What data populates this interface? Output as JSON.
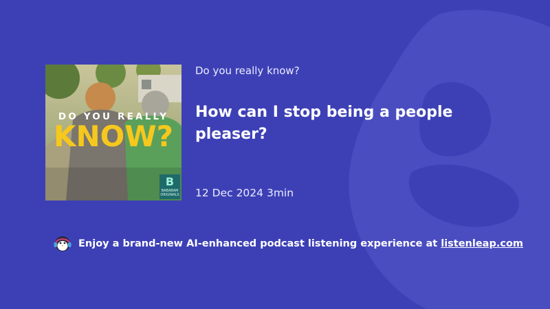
{
  "background_color": "#3d40b5",
  "episode": {
    "show_title": "Do you really know?",
    "title": "How can I stop being a people pleaser?",
    "date": "12 Dec 2024",
    "duration": "3min"
  },
  "cover": {
    "line1": "DO YOU REALLY",
    "line2": "KNOW?",
    "publisher_letter": "B",
    "publisher_name": "BABABAM ORIGINALS"
  },
  "promo": {
    "icon": "penguin-headphones-icon",
    "text": "Enjoy a brand-new AI-enhanced podcast listening experience at ",
    "link_label": "listenleap.com"
  }
}
